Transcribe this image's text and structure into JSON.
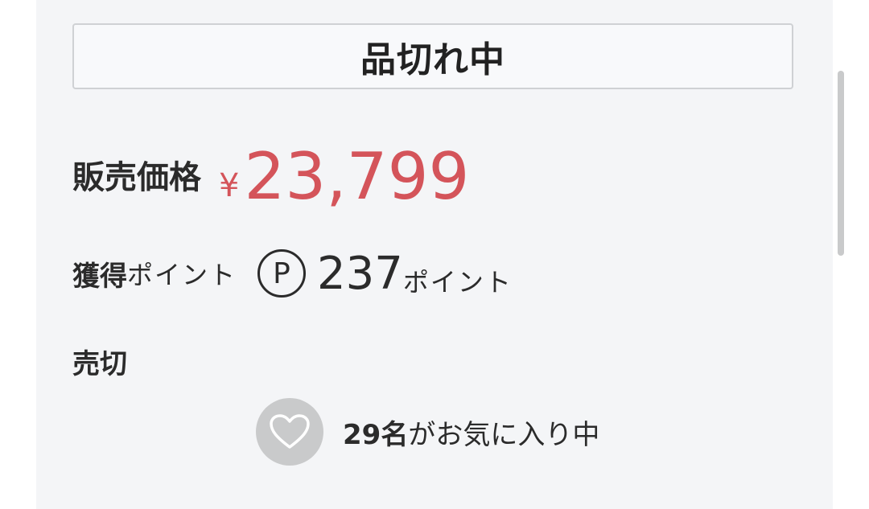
{
  "status": {
    "soldout_label": "品切れ中"
  },
  "price": {
    "label": "販売価格",
    "currency": "¥",
    "value": "23,799"
  },
  "points": {
    "label_main": "獲得",
    "label_sub": "ポイント",
    "icon_letter": "P",
    "value": "237",
    "unit": "ポイント"
  },
  "availability": {
    "text": "売切"
  },
  "favorite": {
    "count_text": "29名",
    "suffix": "がお気に入り中"
  },
  "colors": {
    "price": "#d4545a",
    "panel_bg": "#f4f5f7",
    "heart_bg": "#c9cacb"
  }
}
